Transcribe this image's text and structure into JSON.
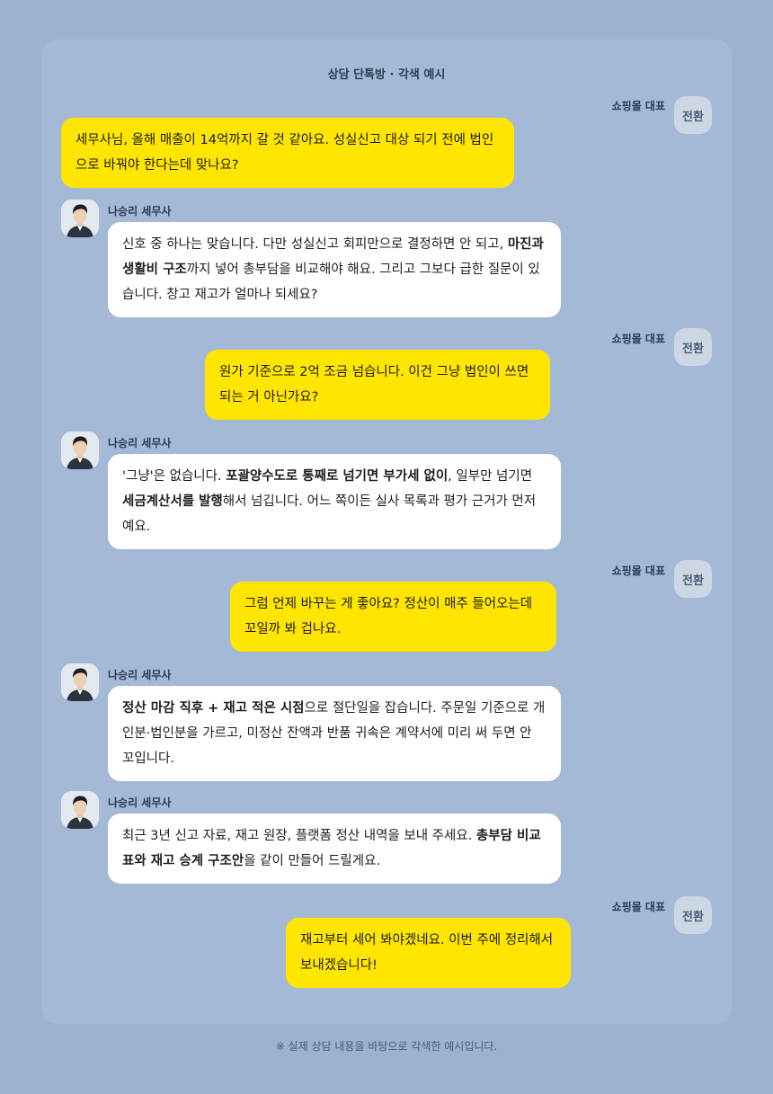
{
  "title": "상담 단톡방 · 각색 예시",
  "footnote": "※ 실제 상담 내용을 바탕으로 각색한 예시입니다.",
  "participants": {
    "ceo": {
      "name": "쇼핑몰 대표",
      "avatar_label": "전환"
    },
    "tax": {
      "name": "나승리 세무사",
      "avatar_icon": "person-avatar-icon"
    }
  },
  "colors": {
    "background": "#9db2cf",
    "panel": "#a4b9d6",
    "ceo_bubble": "#ffe500",
    "tax_bubble": "#ffffff"
  },
  "messages": [
    {
      "from": "ceo",
      "parts": [
        {
          "t": "세무사님, 올해 매출이 14억까지 갈 것 같아요. 성실신고 대상 되기 전에 법인으로 바꿔야 한다는데 맞나요?"
        }
      ]
    },
    {
      "from": "tax",
      "parts": [
        {
          "t": "신호 중 하나는 맞습니다. 다만 성실신고 회피만으로 결정하면 안 되고, "
        },
        {
          "t": "마진과 생활비 구조",
          "b": true
        },
        {
          "t": "까지 넣어 총부담을 비교해야 해요. 그리고 그보다 급한 질문이 있습니다. 창고 재고가 얼마나 되세요?"
        }
      ]
    },
    {
      "from": "ceo",
      "parts": [
        {
          "t": "원가 기준으로 2억 조금 넘습니다. 이건 그냥 법인이 쓰면 되는 거 아닌가요?"
        }
      ]
    },
    {
      "from": "tax",
      "parts": [
        {
          "t": "'그냥'은 없습니다. "
        },
        {
          "t": "포괄양수도로 통째로 넘기면 부가세 없이",
          "b": true
        },
        {
          "t": ", 일부만 넘기면 "
        },
        {
          "t": "세금계산서를 발행",
          "b": true
        },
        {
          "t": "해서 넘깁니다. 어느 쪽이든 실사 목록과 평가 근거가 먼저예요."
        }
      ]
    },
    {
      "from": "ceo",
      "parts": [
        {
          "t": "그럼 언제 바꾸는 게 좋아요? 정산이 매주 들어오는데 꼬일까 봐 겁나요."
        }
      ]
    },
    {
      "from": "tax",
      "parts": [
        {
          "t": "정산 마감 직후 + 재고 적은 시점",
          "b": true
        },
        {
          "t": "으로 절단일을 잡습니다. 주문일 기준으로 개인분·법인분을 가르고, 미정산 잔액과 반품 귀속은 계약서에 미리 써 두면 안 꼬입니다."
        }
      ]
    },
    {
      "from": "tax",
      "parts": [
        {
          "t": "최근 3년 신고 자료, 재고 원장, 플랫폼 정산 내역을 보내 주세요. "
        },
        {
          "t": "총부담 비교표와 재고 승계 구조안",
          "b": true
        },
        {
          "t": "을 같이 만들어 드릴게요."
        }
      ]
    },
    {
      "from": "ceo",
      "parts": [
        {
          "t": "재고부터 세어 봐야겠네요. 이번 주에 정리해서 보내겠습니다!"
        }
      ]
    }
  ]
}
